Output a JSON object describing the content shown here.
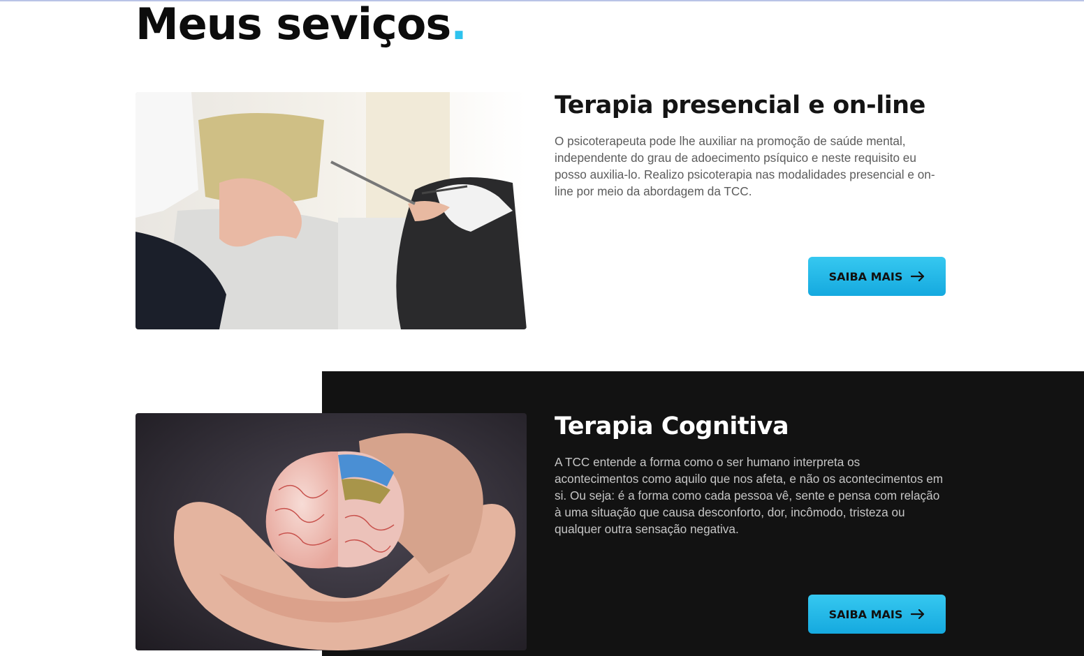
{
  "page": {
    "title": "Meus seviços",
    "title_dot": ".",
    "accent_color": "#2ec3ee",
    "dark_panel_color": "#121212"
  },
  "services": [
    {
      "title": "Terapia presencial e on-line",
      "description": "O psicoterapeuta pode lhe auxiliar na promoção de saúde mental, independente do grau de adoecimento psíquico e neste requisito eu posso auxilia-lo. Realizo psicoterapia nas modalidades presencial e on-line por meio da abordagem da TCC.",
      "button_label": "SAIBA MAIS",
      "button_icon": "arrow-right-icon",
      "image_subject": "therapy-session-photo"
    },
    {
      "title": "Terapia Cognitiva",
      "description": "A TCC entende a forma como o ser humano interpreta os acontecimentos como aquilo que nos afeta, e não os acontecimentos em si. Ou seja: é a forma como cada pessoa vê, sente e pensa com relação à uma situação que causa desconforto, dor, incômodo, tristeza ou qualquer outra sensação negativa.",
      "button_label": "SAIBA MAIS",
      "button_icon": "arrow-right-icon",
      "image_subject": "brain-in-hands-photo"
    }
  ]
}
